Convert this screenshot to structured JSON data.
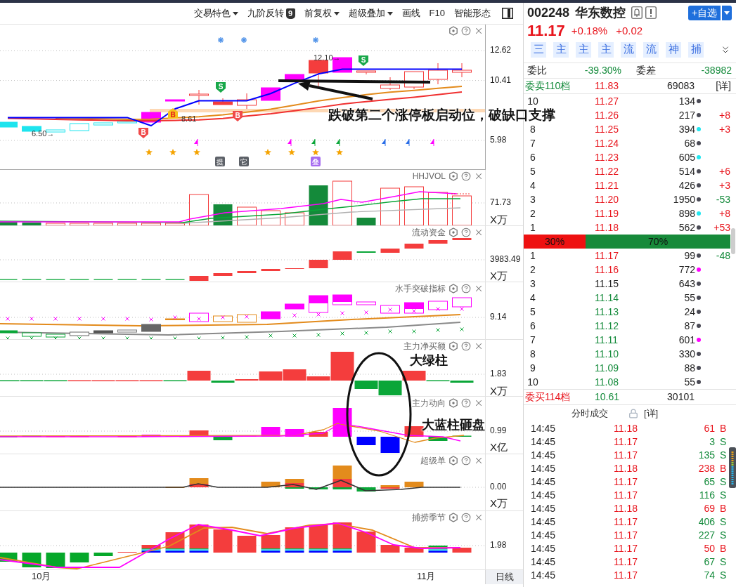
{
  "toolbar": {
    "items": [
      {
        "kind": "dropdown",
        "label": "交易特色"
      },
      {
        "kind": "badge",
        "label": "九阶反转",
        "badge": "9"
      },
      {
        "kind": "dropdown",
        "label": "前复权"
      },
      {
        "kind": "dropdown",
        "label": "超级叠加"
      },
      {
        "kind": "plain",
        "label": "画线"
      },
      {
        "kind": "plain",
        "label": "F10"
      },
      {
        "kind": "plain",
        "label": "智能形态"
      }
    ]
  },
  "main_chart": {
    "chart_data": {
      "type": "line",
      "ylim": [
        3.85,
        14.54
      ],
      "yticks": [
        12.62,
        10.41,
        5.98
      ],
      "grid": true,
      "series": [
        {
          "color": "#0000ff",
          "values": [
            7.67,
            7.67,
            7.67,
            7.67,
            7.67,
            7.67,
            7.07,
            8.31,
            8.91,
            8.91,
            8.91,
            9.44,
            10.2,
            10.89,
            11.24,
            11.24,
            11.24,
            11.24,
            11.24,
            11.24
          ]
        },
        {
          "color": "#e38b1c",
          "values": [
            null,
            null,
            7.64,
            7.6,
            7.57,
            7.54,
            7.55,
            7.64,
            7.73,
            7.87,
            8.07,
            8.29,
            8.59,
            8.9,
            9.14,
            9.36,
            9.54,
            9.68,
            9.83,
            9.97
          ]
        },
        {
          "color": "#f03030",
          "values": [
            7.61,
            7.57,
            7.54,
            7.5,
            7.47,
            7.43,
            7.43,
            7.46,
            7.5,
            7.6,
            7.78,
            7.95,
            8.17,
            8.41,
            8.66,
            8.85,
            9.01,
            9.17,
            9.36,
            9.56
          ]
        }
      ]
    },
    "price_notes": [
      "6.50→",
      "12.10→",
      "8.61"
    ],
    "signals": [
      {
        "kind": "buy",
        "label": "B"
      },
      {
        "kind": "buy-square",
        "label": "B"
      },
      {
        "kind": "sell",
        "label": "S"
      },
      {
        "kind": "buy",
        "label": "B"
      },
      {
        "kind": "sell",
        "label": "S"
      }
    ],
    "event_badges": [
      {
        "label": "提",
        "color": "#5d6168"
      },
      {
        "label": "它",
        "color": "#5d6168"
      },
      {
        "label": "叠",
        "color": "#a66cf0"
      }
    ]
  },
  "panels": [
    {
      "title": "HHJVOL",
      "axis_labels": [
        "71.73",
        "X万"
      ]
    },
    {
      "title": "流动资金",
      "axis_labels": [
        "3983.49",
        "X万"
      ]
    },
    {
      "title": "水手突破指标",
      "axis_labels": [
        "9.14"
      ]
    },
    {
      "title": "主力净买额",
      "axis_labels": [
        "1.83",
        "X万"
      ]
    },
    {
      "title": "主力动向",
      "axis_labels": [
        "0.99",
        "X亿"
      ]
    },
    {
      "title": "超级单",
      "axis_labels": [
        "0.00",
        "X万"
      ]
    },
    {
      "title": "捕捞季节",
      "axis_labels": [
        "1.98"
      ]
    }
  ],
  "x_axis": {
    "labels": [
      "10月",
      "11月"
    ],
    "period": "日线"
  },
  "annotations": [
    "跌破第二个涨停板启动位，破缺口支撑",
    "大绿柱",
    "大蓝柱砸盘"
  ],
  "quote": {
    "code": "002248",
    "name": "华东数控",
    "price": "11.17",
    "change_pct": "+0.18%",
    "change": "+0.02",
    "watch_button": "+自选"
  },
  "shortcut_tabs": [
    "三",
    "主",
    "主",
    "主",
    "流",
    "流",
    "神",
    "捕"
  ],
  "order_book": {
    "ratio_label": "委比",
    "ratio": "-39.30%",
    "diff_label": "委差",
    "diff": "-38982",
    "ask_total": {
      "label": "委卖110档",
      "price": "11.83",
      "volume": "69083",
      "detail": "[详]"
    },
    "asks": [
      {
        "level": "10",
        "price": {
          "text": "11.27",
          "color": "#e8141c"
        },
        "volume": "134",
        "color": "#4a4a55"
      },
      {
        "price": {
          "text": "11.26",
          "color": "#e8141c"
        },
        "volume": "217",
        "color": "#4a4a55",
        "change": {
          "text": "+8",
          "color": "#e8141c"
        }
      },
      {
        "level": "8",
        "price": {
          "text": "11.25",
          "color": "#e8141c"
        },
        "volume": "394",
        "color": "#22e6f0",
        "change": {
          "text": "+3",
          "color": "#e8141c"
        }
      },
      {
        "level": "7",
        "price": {
          "text": "11.24",
          "color": "#e8141c"
        },
        "volume": "68",
        "color": "#4a4a55"
      },
      {
        "level": "6",
        "price": {
          "text": "11.23",
          "color": "#e8141c"
        },
        "volume": "605",
        "color": "#22e6f0"
      },
      {
        "level": "5",
        "price": {
          "text": "11.22",
          "color": "#e8141c"
        },
        "volume": "514",
        "color": "#4a4a55",
        "change": {
          "text": "+6",
          "color": "#e8141c"
        }
      },
      {
        "level": "4",
        "price": {
          "text": "11.21",
          "color": "#e8141c"
        },
        "volume": "426",
        "color": "#4a4a55",
        "change": {
          "text": "+3",
          "color": "#e8141c"
        }
      },
      {
        "level": "3",
        "price": {
          "text": "11.20",
          "color": "#e8141c"
        },
        "volume": "1950",
        "color": "#4a4a55",
        "change": {
          "text": "-53",
          "color": "#138a3a"
        }
      },
      {
        "level": "2",
        "price": {
          "text": "11.19",
          "color": "#e8141c"
        },
        "volume": "898",
        "color": "#22e6f0",
        "change": {
          "text": "+8",
          "color": "#e8141c"
        }
      },
      {
        "level": "1",
        "price": {
          "text": "11.18",
          "color": "#e8141c"
        },
        "volume": "562",
        "color": "#4a4a55",
        "change": {
          "text": "+53",
          "color": "#e8141c"
        }
      }
    ],
    "ratio_bar": {
      "buy_label": "30%",
      "sell_label": "70%",
      "level": 0.3
    },
    "bids": [
      {
        "level": "1",
        "price": {
          "text": "11.17",
          "color": "#e8141c"
        },
        "volume": "99",
        "color": "#4a4a55",
        "change": {
          "text": "-48",
          "color": "#138a3a"
        }
      },
      {
        "level": "2",
        "price": {
          "text": "11.16",
          "color": "#e8141c"
        },
        "volume": "772",
        "color": "#ff00ff"
      },
      {
        "level": "3",
        "price": {
          "text": "11.15",
          "color": "#222222"
        },
        "volume": "643",
        "color": "#4a4a55"
      },
      {
        "level": "4",
        "price": {
          "text": "11.14",
          "color": "#138a3a"
        },
        "volume": "55",
        "color": "#4a4a55"
      },
      {
        "level": "5",
        "price": {
          "text": "11.13",
          "color": "#138a3a"
        },
        "volume": "24",
        "color": "#4a4a55"
      },
      {
        "level": "6",
        "price": {
          "text": "11.12",
          "color": "#138a3a"
        },
        "volume": "87",
        "color": "#4a4a55"
      },
      {
        "level": "7",
        "price": {
          "text": "11.11",
          "color": "#138a3a"
        },
        "volume": "601",
        "color": "#ff00ff"
      },
      {
        "level": "8",
        "price": {
          "text": "11.10",
          "color": "#138a3a"
        },
        "volume": "330",
        "color": "#4a4a55"
      },
      {
        "level": "9",
        "price": {
          "text": "11.09",
          "color": "#138a3a"
        },
        "volume": "88",
        "color": "#4a4a55"
      },
      {
        "level": "10",
        "price": {
          "text": "11.08",
          "color": "#138a3a"
        },
        "volume": "55",
        "color": "#4a4a55"
      }
    ],
    "bid_total": {
      "label": "委买114档",
      "price": "10.61",
      "volume": "30101"
    }
  },
  "trades": {
    "title": "分时成交",
    "detail": "[详]",
    "rows": [
      {
        "time": "14:45",
        "price": "11.18",
        "volume": "61",
        "side": "B",
        "color": "#e8141c"
      },
      {
        "time": "14:45",
        "price": "11.17",
        "volume": "3",
        "side": "S",
        "color": "#138a3a"
      },
      {
        "time": "14:45",
        "price": "11.17",
        "volume": "135",
        "side": "S",
        "color": "#138a3a"
      },
      {
        "time": "14:45",
        "price": "11.18",
        "volume": "238",
        "side": "B",
        "color": "#e8141c"
      },
      {
        "time": "14:45",
        "price": "11.17",
        "volume": "65",
        "side": "S",
        "color": "#138a3a"
      },
      {
        "time": "14:45",
        "price": "11.17",
        "volume": "116",
        "side": "S",
        "color": "#138a3a"
      },
      {
        "time": "14:45",
        "price": "11.18",
        "volume": "69",
        "side": "B",
        "color": "#e8141c"
      },
      {
        "time": "14:45",
        "price": "11.17",
        "volume": "406",
        "side": "S",
        "color": "#138a3a"
      },
      {
        "time": "14:45",
        "price": "11.17",
        "volume": "227",
        "side": "S",
        "color": "#138a3a"
      },
      {
        "time": "14:45",
        "price": "11.17",
        "volume": "50",
        "side": "B",
        "color": "#e8141c"
      },
      {
        "time": "14:45",
        "price": "11.17",
        "volume": "67",
        "side": "S",
        "color": "#138a3a"
      },
      {
        "time": "14:45",
        "price": "11.17",
        "volume": "74",
        "side": "S",
        "color": "#138a3a"
      }
    ]
  }
}
